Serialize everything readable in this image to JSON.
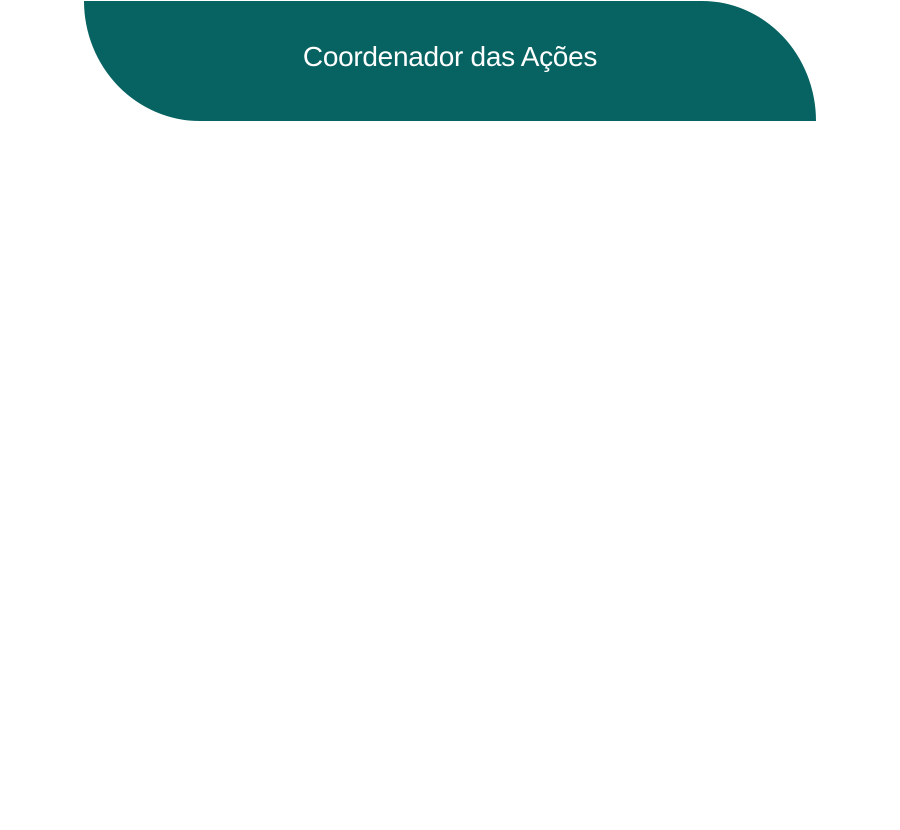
{
  "header": {
    "title": "Coordenador das Ações"
  },
  "colors": {
    "banner": "#066362",
    "title_text": "#ffffff",
    "background": "#ffffff"
  }
}
